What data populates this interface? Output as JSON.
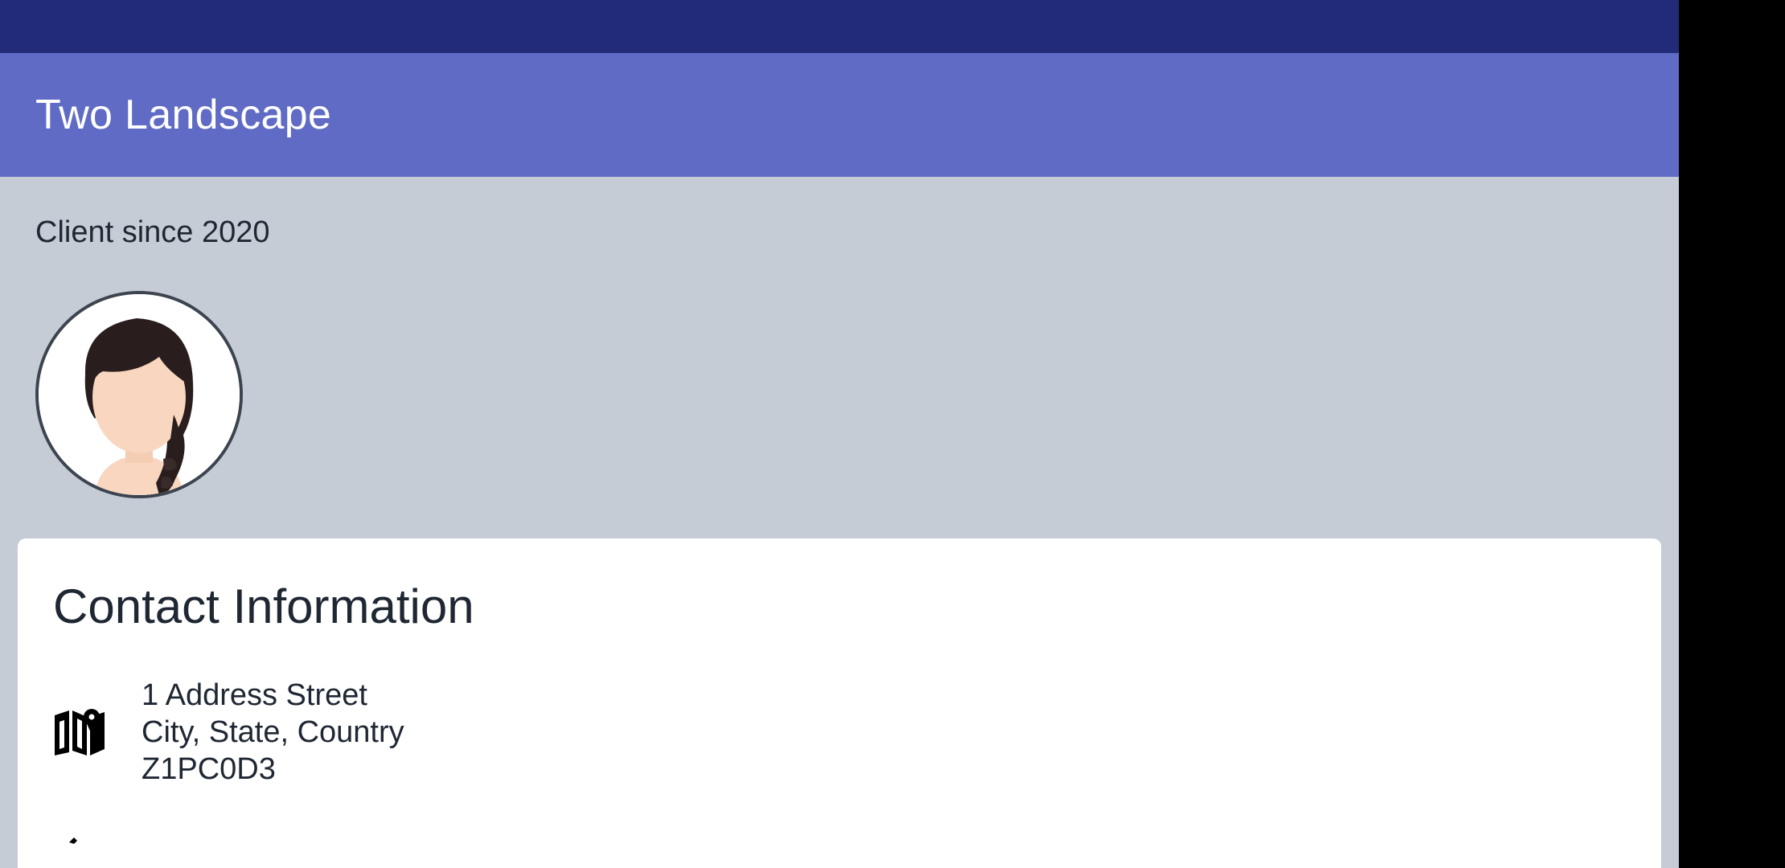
{
  "app_bar": {
    "title": "Two Landscape"
  },
  "profile": {
    "client_since": "Client since 2020",
    "avatar_icon": "female-avatar"
  },
  "contact_card": {
    "title": "Contact Information",
    "address": {
      "icon": "map-icon",
      "line1": "1 Address Street",
      "line2": "City, State, Country",
      "line3": "Z1PC0D3"
    }
  },
  "colors": {
    "status_bar": "#212b78",
    "app_bar": "#5f6bc4",
    "background": "#c5ccd6",
    "card": "#ffffff",
    "text": "#1f2733"
  }
}
